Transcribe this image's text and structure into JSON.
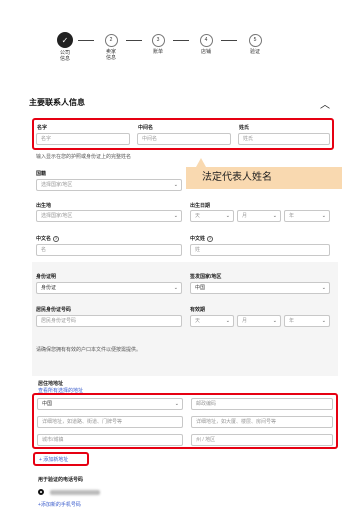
{
  "stepper": {
    "steps": [
      {
        "num": "✓",
        "label": "公司\n信息"
      },
      {
        "num": "2",
        "label": "卖家\n信息"
      },
      {
        "num": "3",
        "label": "账单"
      },
      {
        "num": "4",
        "label": "店铺"
      },
      {
        "num": "5",
        "label": "验证"
      }
    ]
  },
  "section": {
    "title": "主要联系人信息",
    "collapse_icon": "chevron-up-icon"
  },
  "name": {
    "first_label": "名字",
    "first_placeholder": "名字",
    "middle_label": "中间名",
    "middle_placeholder": "中间名",
    "last_label": "姓氏",
    "last_placeholder": "姓氏",
    "hint": "输入显示在您的护照或身份证上的完整姓名"
  },
  "callout": {
    "text": "法定代表人姓名"
  },
  "nationality": {
    "label": "国籍",
    "placeholder": "选择国家/地区"
  },
  "birthplace": {
    "label": "出生地",
    "placeholder": "选择国家/地区"
  },
  "birthdate": {
    "label": "出生日期",
    "day": "天",
    "month": "月",
    "year": "年"
  },
  "chinese_name": {
    "first_label": "中文名",
    "first_placeholder": "名",
    "last_label": "中文姓",
    "last_placeholder": "姓"
  },
  "id_doc": {
    "type_label": "身份证明",
    "type_value": "身份证",
    "country_label": "签发国家/地区",
    "country_value": "中国",
    "number_label": "居民身份证号码",
    "number_placeholder": "居民身份证号码",
    "expiry_label": "有效期",
    "day": "天",
    "month": "月",
    "year": "年",
    "note": "请确保您拥有有效的户口本文件以便按需提供。"
  },
  "address": {
    "label": "居住地地址",
    "sub_label": "查看所有选择的地址",
    "country_value": "中国",
    "postal_placeholder": "邮政编码",
    "line1_placeholder": "详细地址，如道路、街道、门牌号等",
    "line2_placeholder": "详细地址，如大厦、楼层、房间号等",
    "city_placeholder": "城市/城镇",
    "state_placeholder": "州 / 地区",
    "add_link": "+ 添加新地址"
  },
  "phone": {
    "label": "用于验证的电话号码",
    "add_link": "+添加新的手机号码"
  },
  "colors": {
    "highlight": "#e60012",
    "callout_bg": "#f9d9b0",
    "link": "#3a5ccc"
  }
}
